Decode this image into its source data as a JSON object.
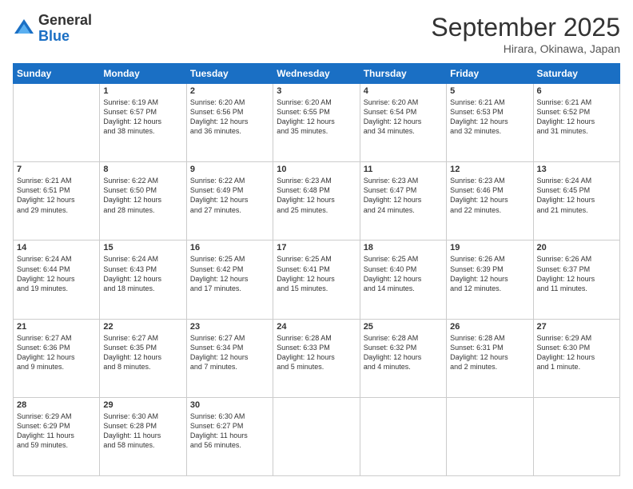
{
  "logo": {
    "general": "General",
    "blue": "Blue"
  },
  "header": {
    "month_year": "September 2025",
    "location": "Hirara, Okinawa, Japan"
  },
  "days_of_week": [
    "Sunday",
    "Monday",
    "Tuesday",
    "Wednesday",
    "Thursday",
    "Friday",
    "Saturday"
  ],
  "weeks": [
    [
      {
        "day": "",
        "text": ""
      },
      {
        "day": "1",
        "text": "Sunrise: 6:19 AM\nSunset: 6:57 PM\nDaylight: 12 hours\nand 38 minutes."
      },
      {
        "day": "2",
        "text": "Sunrise: 6:20 AM\nSunset: 6:56 PM\nDaylight: 12 hours\nand 36 minutes."
      },
      {
        "day": "3",
        "text": "Sunrise: 6:20 AM\nSunset: 6:55 PM\nDaylight: 12 hours\nand 35 minutes."
      },
      {
        "day": "4",
        "text": "Sunrise: 6:20 AM\nSunset: 6:54 PM\nDaylight: 12 hours\nand 34 minutes."
      },
      {
        "day": "5",
        "text": "Sunrise: 6:21 AM\nSunset: 6:53 PM\nDaylight: 12 hours\nand 32 minutes."
      },
      {
        "day": "6",
        "text": "Sunrise: 6:21 AM\nSunset: 6:52 PM\nDaylight: 12 hours\nand 31 minutes."
      }
    ],
    [
      {
        "day": "7",
        "text": "Sunrise: 6:21 AM\nSunset: 6:51 PM\nDaylight: 12 hours\nand 29 minutes."
      },
      {
        "day": "8",
        "text": "Sunrise: 6:22 AM\nSunset: 6:50 PM\nDaylight: 12 hours\nand 28 minutes."
      },
      {
        "day": "9",
        "text": "Sunrise: 6:22 AM\nSunset: 6:49 PM\nDaylight: 12 hours\nand 27 minutes."
      },
      {
        "day": "10",
        "text": "Sunrise: 6:23 AM\nSunset: 6:48 PM\nDaylight: 12 hours\nand 25 minutes."
      },
      {
        "day": "11",
        "text": "Sunrise: 6:23 AM\nSunset: 6:47 PM\nDaylight: 12 hours\nand 24 minutes."
      },
      {
        "day": "12",
        "text": "Sunrise: 6:23 AM\nSunset: 6:46 PM\nDaylight: 12 hours\nand 22 minutes."
      },
      {
        "day": "13",
        "text": "Sunrise: 6:24 AM\nSunset: 6:45 PM\nDaylight: 12 hours\nand 21 minutes."
      }
    ],
    [
      {
        "day": "14",
        "text": "Sunrise: 6:24 AM\nSunset: 6:44 PM\nDaylight: 12 hours\nand 19 minutes."
      },
      {
        "day": "15",
        "text": "Sunrise: 6:24 AM\nSunset: 6:43 PM\nDaylight: 12 hours\nand 18 minutes."
      },
      {
        "day": "16",
        "text": "Sunrise: 6:25 AM\nSunset: 6:42 PM\nDaylight: 12 hours\nand 17 minutes."
      },
      {
        "day": "17",
        "text": "Sunrise: 6:25 AM\nSunset: 6:41 PM\nDaylight: 12 hours\nand 15 minutes."
      },
      {
        "day": "18",
        "text": "Sunrise: 6:25 AM\nSunset: 6:40 PM\nDaylight: 12 hours\nand 14 minutes."
      },
      {
        "day": "19",
        "text": "Sunrise: 6:26 AM\nSunset: 6:39 PM\nDaylight: 12 hours\nand 12 minutes."
      },
      {
        "day": "20",
        "text": "Sunrise: 6:26 AM\nSunset: 6:37 PM\nDaylight: 12 hours\nand 11 minutes."
      }
    ],
    [
      {
        "day": "21",
        "text": "Sunrise: 6:27 AM\nSunset: 6:36 PM\nDaylight: 12 hours\nand 9 minutes."
      },
      {
        "day": "22",
        "text": "Sunrise: 6:27 AM\nSunset: 6:35 PM\nDaylight: 12 hours\nand 8 minutes."
      },
      {
        "day": "23",
        "text": "Sunrise: 6:27 AM\nSunset: 6:34 PM\nDaylight: 12 hours\nand 7 minutes."
      },
      {
        "day": "24",
        "text": "Sunrise: 6:28 AM\nSunset: 6:33 PM\nDaylight: 12 hours\nand 5 minutes."
      },
      {
        "day": "25",
        "text": "Sunrise: 6:28 AM\nSunset: 6:32 PM\nDaylight: 12 hours\nand 4 minutes."
      },
      {
        "day": "26",
        "text": "Sunrise: 6:28 AM\nSunset: 6:31 PM\nDaylight: 12 hours\nand 2 minutes."
      },
      {
        "day": "27",
        "text": "Sunrise: 6:29 AM\nSunset: 6:30 PM\nDaylight: 12 hours\nand 1 minute."
      }
    ],
    [
      {
        "day": "28",
        "text": "Sunrise: 6:29 AM\nSunset: 6:29 PM\nDaylight: 11 hours\nand 59 minutes."
      },
      {
        "day": "29",
        "text": "Sunrise: 6:30 AM\nSunset: 6:28 PM\nDaylight: 11 hours\nand 58 minutes."
      },
      {
        "day": "30",
        "text": "Sunrise: 6:30 AM\nSunset: 6:27 PM\nDaylight: 11 hours\nand 56 minutes."
      },
      {
        "day": "",
        "text": ""
      },
      {
        "day": "",
        "text": ""
      },
      {
        "day": "",
        "text": ""
      },
      {
        "day": "",
        "text": ""
      }
    ]
  ]
}
